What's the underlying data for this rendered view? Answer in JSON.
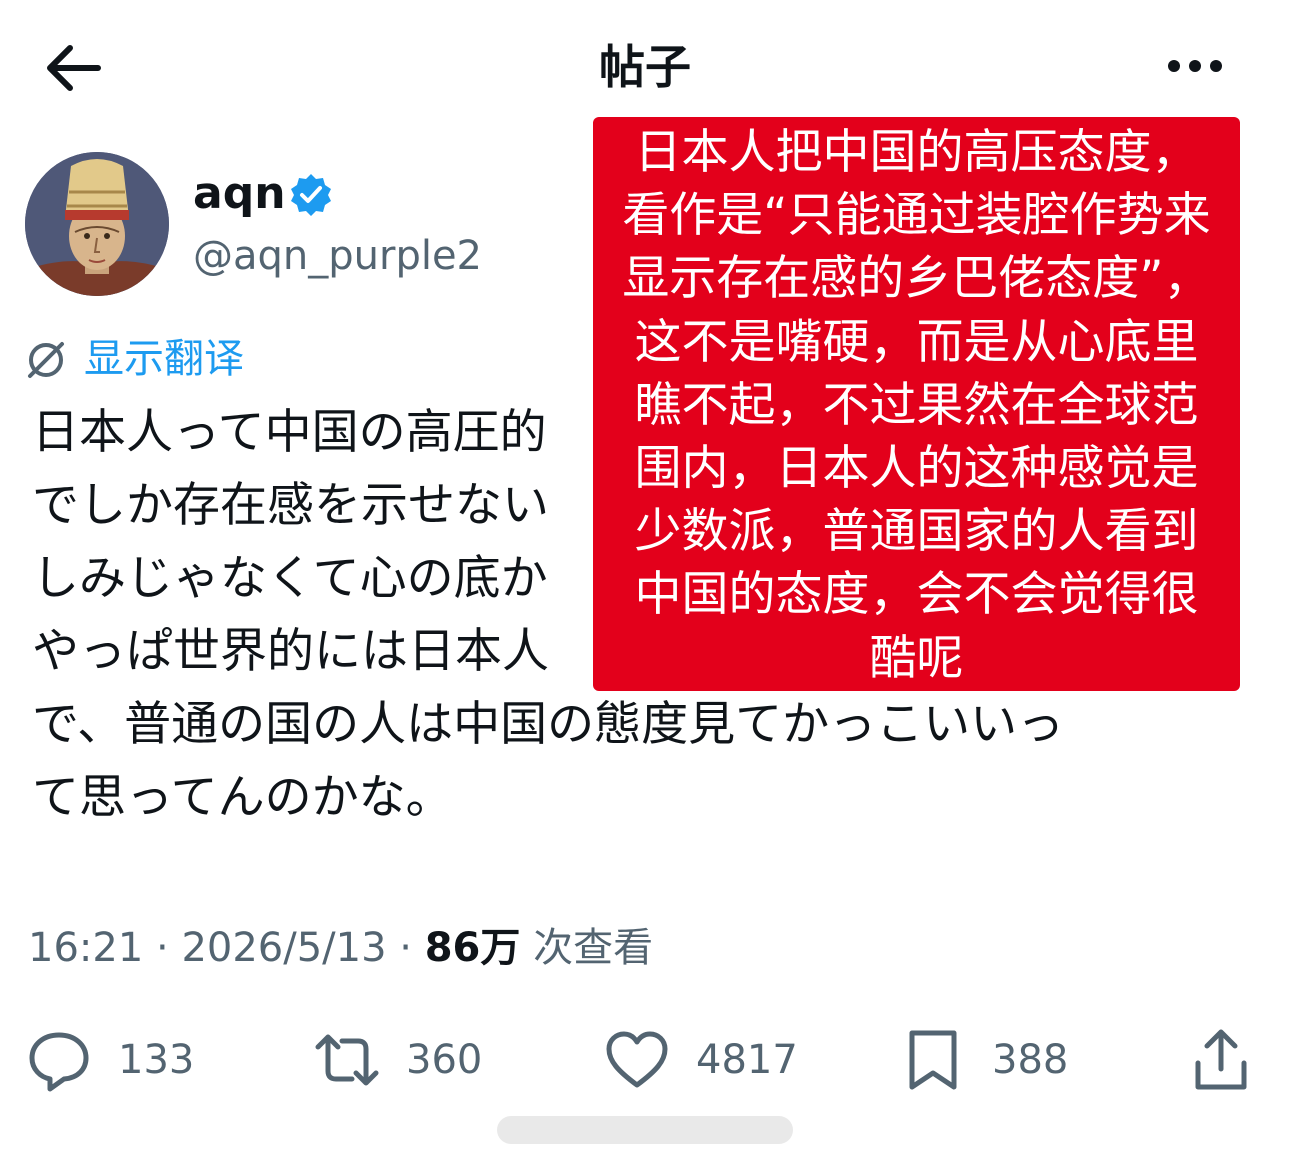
{
  "header": {
    "title": "帖子",
    "back_icon": "arrow-left-icon",
    "more_icon": "more-horizontal-icon"
  },
  "author": {
    "display_name": "aqn",
    "handle": "@aqn_purple2",
    "verified": true,
    "verified_color": "#1d9bf0"
  },
  "translate": {
    "label": "显示翻译",
    "icon": "translate-icon"
  },
  "post": {
    "lines": [
      "日本人って中国の高圧的",
      "でしか存在感を示せない",
      "しみじゃなくて心の底か",
      "やっぱ世界的には日本人",
      "で、普通の国の人は中国の態度見てかっこいいっ",
      "て思ってんのかな。"
    ]
  },
  "overlay": {
    "background": "#e3001b",
    "lines": [
      "日本人把中国的高压态度，",
      "看作是“只能通过装腔作势来",
      "显示存在感的乡巴佬态度”，",
      "这不是嘴硬，而是从心底里",
      "瞧不起，不过果然在全球范",
      "围内，日本人的这种感觉是",
      "少数派，普通国家的人看到",
      "中国的态度，会不会觉得很",
      "酷呢"
    ]
  },
  "meta": {
    "time": "16:21",
    "date": "2026/5/13",
    "views": "86万",
    "views_label": "次查看",
    "separator": "·"
  },
  "actions": {
    "reply": {
      "count": "133",
      "icon": "reply-icon"
    },
    "retweet": {
      "count": "360",
      "icon": "retweet-icon"
    },
    "like": {
      "count": "4817",
      "icon": "heart-icon"
    },
    "bookmark": {
      "count": "388",
      "icon": "bookmark-icon"
    },
    "share": {
      "icon": "share-icon"
    }
  },
  "colors": {
    "text": "#0f1419",
    "secondary": "#536471",
    "link": "#1d9bf0"
  }
}
